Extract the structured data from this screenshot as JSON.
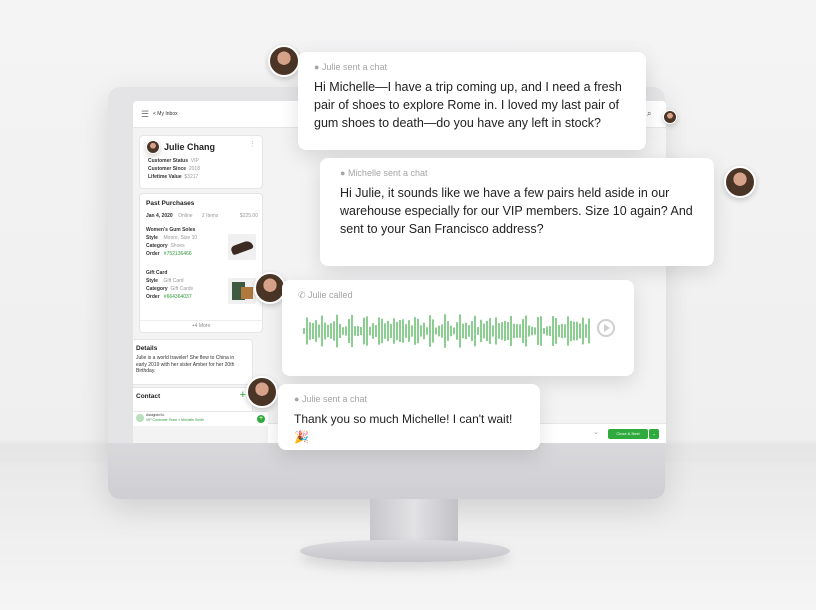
{
  "topbar": {
    "breadcrumb": "< My Inbox"
  },
  "customer": {
    "name": "Julie Chang",
    "fields": [
      {
        "label": "Customer Status",
        "value": "VIP"
      },
      {
        "label": "Customer Since",
        "value": "2018"
      },
      {
        "label": "Lifetime Value",
        "value": "$3217"
      }
    ]
  },
  "past_purchases": {
    "title": "Past Purchases",
    "order_header": {
      "date": "Jan 4, 2020",
      "channel": "Online",
      "items": "2 Items",
      "total": "$225.00"
    },
    "items": [
      {
        "name": "Women's Gum Soles",
        "rows": [
          {
            "label": "Style",
            "value": "Moore, Size 10"
          },
          {
            "label": "Category",
            "value": "Shoes"
          },
          {
            "label": "Order",
            "value": "#752136466"
          }
        ]
      },
      {
        "name": "Gift Card",
        "rows": [
          {
            "label": "Style",
            "value": "Gift Card"
          },
          {
            "label": "Category",
            "value": "Gift Cards"
          },
          {
            "label": "Order",
            "value": "#664364037"
          }
        ]
      }
    ],
    "more": "+4 More"
  },
  "details": {
    "title": "Details",
    "text": "Julie is a world traveler! She flew to China in early 2019 with her sister Amber for her 20th Birthday."
  },
  "contact": {
    "title": "Contact",
    "add": "+"
  },
  "assigned": {
    "label": "Assigned to",
    "value": "VIP Customer Team > Michelle Smith"
  },
  "close_button": "Close & Next",
  "chats": [
    {
      "label": "Julie sent a chat",
      "text": "Hi Michelle—I have a trip coming up, and I need a fresh pair of shoes to explore Rome in. I loved my last pair of gum shoes to death—do you have any left in stock?"
    },
    {
      "label": "Michelle sent a chat",
      "text": "Hi Julie, it sounds like we have a few pairs held aside in our warehouse especially for our VIP members. Size 10 again? And sent to your San Francisco address?"
    },
    {
      "label": "Julie called",
      "text": ""
    },
    {
      "label": "Julie sent a chat",
      "text": "Thank you so much Michelle! I can't wait! 🎉"
    }
  ],
  "colors": {
    "accent": "#2faa3c",
    "wave": "#3fae4a",
    "text": "#222222",
    "muted": "#a5a5a5"
  },
  "icons": [
    "hamburger-icon",
    "search-icon",
    "chat-bubble-icon",
    "phone-icon",
    "play-icon",
    "more-vertical-icon"
  ]
}
